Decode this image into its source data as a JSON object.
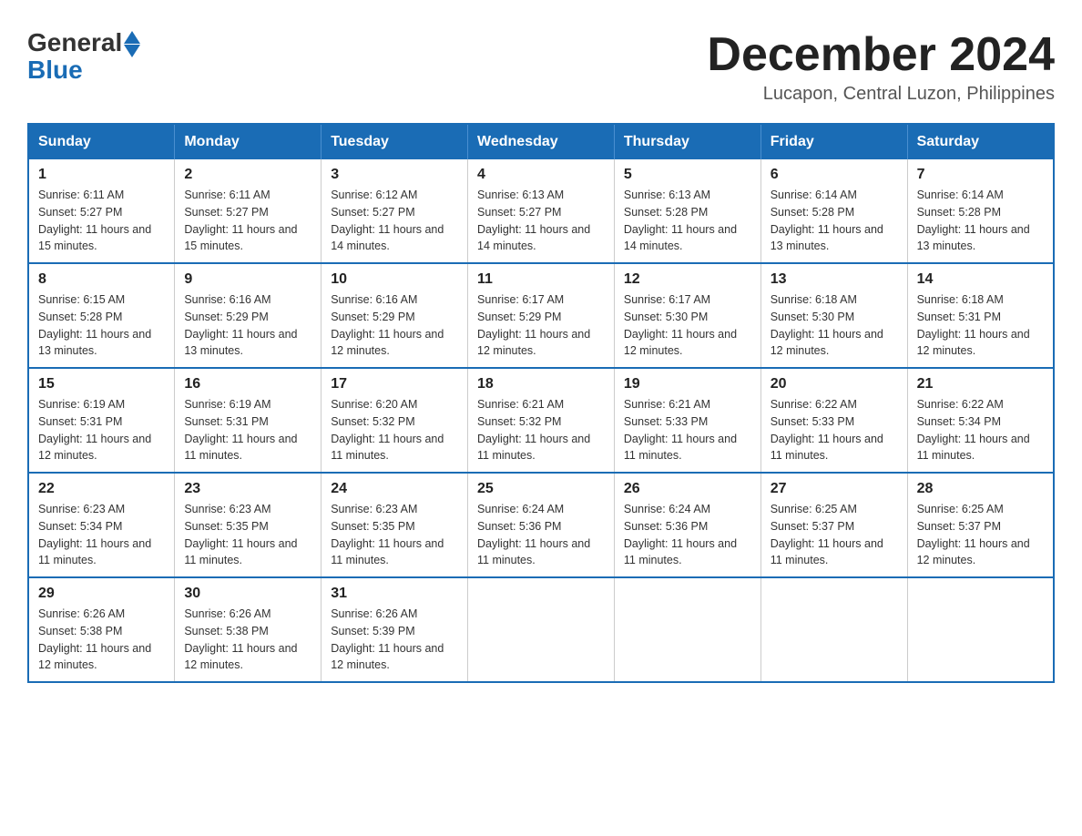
{
  "logo": {
    "general": "General",
    "blue": "Blue"
  },
  "title": "December 2024",
  "location": "Lucapon, Central Luzon, Philippines",
  "days_header": [
    "Sunday",
    "Monday",
    "Tuesday",
    "Wednesday",
    "Thursday",
    "Friday",
    "Saturday"
  ],
  "weeks": [
    [
      {
        "day": "1",
        "sunrise": "6:11 AM",
        "sunset": "5:27 PM",
        "daylight": "11 hours and 15 minutes."
      },
      {
        "day": "2",
        "sunrise": "6:11 AM",
        "sunset": "5:27 PM",
        "daylight": "11 hours and 15 minutes."
      },
      {
        "day": "3",
        "sunrise": "6:12 AM",
        "sunset": "5:27 PM",
        "daylight": "11 hours and 14 minutes."
      },
      {
        "day": "4",
        "sunrise": "6:13 AM",
        "sunset": "5:27 PM",
        "daylight": "11 hours and 14 minutes."
      },
      {
        "day": "5",
        "sunrise": "6:13 AM",
        "sunset": "5:28 PM",
        "daylight": "11 hours and 14 minutes."
      },
      {
        "day": "6",
        "sunrise": "6:14 AM",
        "sunset": "5:28 PM",
        "daylight": "11 hours and 13 minutes."
      },
      {
        "day": "7",
        "sunrise": "6:14 AM",
        "sunset": "5:28 PM",
        "daylight": "11 hours and 13 minutes."
      }
    ],
    [
      {
        "day": "8",
        "sunrise": "6:15 AM",
        "sunset": "5:28 PM",
        "daylight": "11 hours and 13 minutes."
      },
      {
        "day": "9",
        "sunrise": "6:16 AM",
        "sunset": "5:29 PM",
        "daylight": "11 hours and 13 minutes."
      },
      {
        "day": "10",
        "sunrise": "6:16 AM",
        "sunset": "5:29 PM",
        "daylight": "11 hours and 12 minutes."
      },
      {
        "day": "11",
        "sunrise": "6:17 AM",
        "sunset": "5:29 PM",
        "daylight": "11 hours and 12 minutes."
      },
      {
        "day": "12",
        "sunrise": "6:17 AM",
        "sunset": "5:30 PM",
        "daylight": "11 hours and 12 minutes."
      },
      {
        "day": "13",
        "sunrise": "6:18 AM",
        "sunset": "5:30 PM",
        "daylight": "11 hours and 12 minutes."
      },
      {
        "day": "14",
        "sunrise": "6:18 AM",
        "sunset": "5:31 PM",
        "daylight": "11 hours and 12 minutes."
      }
    ],
    [
      {
        "day": "15",
        "sunrise": "6:19 AM",
        "sunset": "5:31 PM",
        "daylight": "11 hours and 12 minutes."
      },
      {
        "day": "16",
        "sunrise": "6:19 AM",
        "sunset": "5:31 PM",
        "daylight": "11 hours and 11 minutes."
      },
      {
        "day": "17",
        "sunrise": "6:20 AM",
        "sunset": "5:32 PM",
        "daylight": "11 hours and 11 minutes."
      },
      {
        "day": "18",
        "sunrise": "6:21 AM",
        "sunset": "5:32 PM",
        "daylight": "11 hours and 11 minutes."
      },
      {
        "day": "19",
        "sunrise": "6:21 AM",
        "sunset": "5:33 PM",
        "daylight": "11 hours and 11 minutes."
      },
      {
        "day": "20",
        "sunrise": "6:22 AM",
        "sunset": "5:33 PM",
        "daylight": "11 hours and 11 minutes."
      },
      {
        "day": "21",
        "sunrise": "6:22 AM",
        "sunset": "5:34 PM",
        "daylight": "11 hours and 11 minutes."
      }
    ],
    [
      {
        "day": "22",
        "sunrise": "6:23 AM",
        "sunset": "5:34 PM",
        "daylight": "11 hours and 11 minutes."
      },
      {
        "day": "23",
        "sunrise": "6:23 AM",
        "sunset": "5:35 PM",
        "daylight": "11 hours and 11 minutes."
      },
      {
        "day": "24",
        "sunrise": "6:23 AM",
        "sunset": "5:35 PM",
        "daylight": "11 hours and 11 minutes."
      },
      {
        "day": "25",
        "sunrise": "6:24 AM",
        "sunset": "5:36 PM",
        "daylight": "11 hours and 11 minutes."
      },
      {
        "day": "26",
        "sunrise": "6:24 AM",
        "sunset": "5:36 PM",
        "daylight": "11 hours and 11 minutes."
      },
      {
        "day": "27",
        "sunrise": "6:25 AM",
        "sunset": "5:37 PM",
        "daylight": "11 hours and 11 minutes."
      },
      {
        "day": "28",
        "sunrise": "6:25 AM",
        "sunset": "5:37 PM",
        "daylight": "11 hours and 12 minutes."
      }
    ],
    [
      {
        "day": "29",
        "sunrise": "6:26 AM",
        "sunset": "5:38 PM",
        "daylight": "11 hours and 12 minutes."
      },
      {
        "day": "30",
        "sunrise": "6:26 AM",
        "sunset": "5:38 PM",
        "daylight": "11 hours and 12 minutes."
      },
      {
        "day": "31",
        "sunrise": "6:26 AM",
        "sunset": "5:39 PM",
        "daylight": "11 hours and 12 minutes."
      },
      null,
      null,
      null,
      null
    ]
  ]
}
